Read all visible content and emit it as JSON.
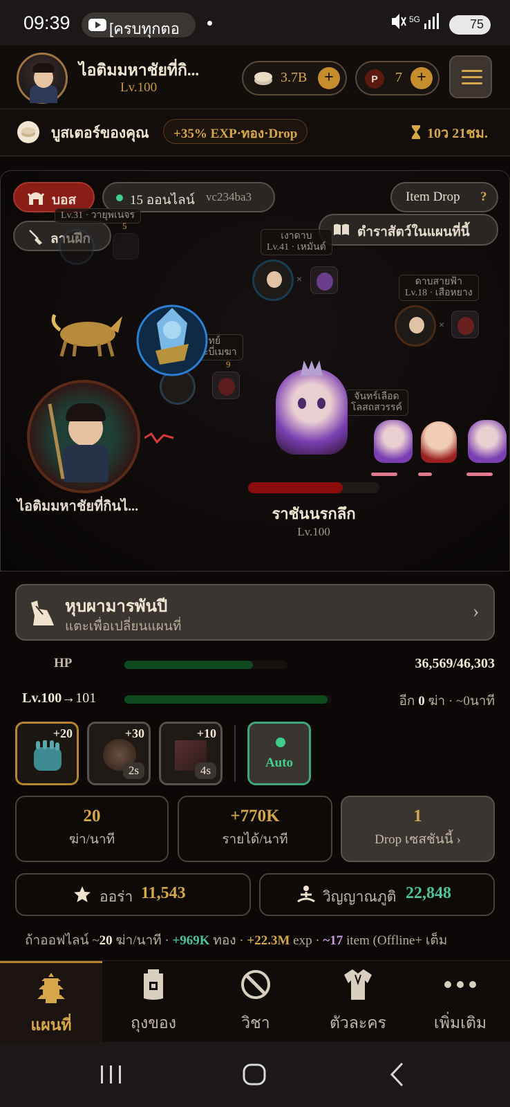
{
  "status_bar": {
    "time": "09:39",
    "notification": "[ครบทุกตอ",
    "network": "5G",
    "battery": "75"
  },
  "header": {
    "player_name": "ไอติมมหาชัยที่กิ...",
    "player_level": "Lv.100",
    "gold": "3.7B",
    "points_icon": "P",
    "points": "7",
    "menu_icon": "hamburger-icon"
  },
  "booster": {
    "label": "บูสเตอร์ของคุณ",
    "effect": "+35% EXP·ทอง·Drop",
    "time_left": "10ว 21ชม."
  },
  "battle": {
    "boss_tab": "บอส",
    "online_count": "15 ออนไลน์",
    "server_code": "vc234ba3",
    "item_drop": "Item Drop",
    "item_drop_help": "?",
    "training_tab": "ลานฝึก",
    "bestiary": "ตำราสัตว์ในแผนที่นี้",
    "others": [
      {
        "name": "เงาดาบ",
        "sub": "Lv.41 · เหมันต์"
      },
      {
        "name": "ดาบสายฟ้า",
        "sub": "Lv.18 · เสือหยาง"
      },
      {
        "name": "ทย์",
        "sub": "กระบี่เมฆา",
        "count": "9"
      },
      {
        "name": "จันทร์เลือด",
        "sub": "โลสถสวรรค์"
      },
      {
        "name": "",
        "sub": "Lv.31 · วายุพเนจร",
        "count": "5"
      }
    ],
    "player_label": "ไอติมมหาชัยที่กินไ...",
    "boss_name": "ราชันนรกลึก",
    "boss_level": "Lv.100",
    "boss_hp_fraction": 0.72
  },
  "map": {
    "title": "หุบผามารพันปี",
    "subtitle": "แตะเพื่อเปลี่ยนแผนที่",
    "chevron": "›"
  },
  "stats": {
    "hp_label": "HP",
    "hp_value": "36,569/46,303",
    "hp_fraction": 0.79,
    "level_from": "Lv.100",
    "arrow": "→",
    "level_to": "101",
    "exp_fraction": 0.98,
    "exp_remaining_prefix": "อีก",
    "exp_remaining_count": "0",
    "exp_remaining_suffix": "ฆ่า · ~0นาที"
  },
  "skills": [
    {
      "bonus": "+20",
      "cooldown": ""
    },
    {
      "bonus": "+30",
      "cooldown": "2s"
    },
    {
      "bonus": "+10",
      "cooldown": "4s"
    }
  ],
  "auto_label": "Auto",
  "summary": {
    "kills_value": "20",
    "kills_label": "ฆ่า/นาที",
    "income_value": "+770K",
    "income_label": "รายได้/นาที",
    "drop_value": "1",
    "drop_label": "Drop เซสชันนี้ ›"
  },
  "aura": {
    "label": "ออร่า",
    "value": "11,543"
  },
  "spirit": {
    "label": "วิญญาณภูติ",
    "value": "22,848"
  },
  "offline": {
    "prefix": "ถ้าออฟไลน์ ~",
    "kills": "20",
    "kills_suffix": " ฆ่า/นาที · ",
    "gold": "+969K",
    "gold_suffix": " ทอง · ",
    "exp": "+22.3M",
    "exp_suffix": " exp · ",
    "items": "~17",
    "items_suffix": " item (Offline+ เต็ม"
  },
  "nav": [
    {
      "label": "แผนที่",
      "icon": "pagoda-icon"
    },
    {
      "label": "ถุงของ",
      "icon": "bag-icon"
    },
    {
      "label": "วิชา",
      "icon": "sword-icon"
    },
    {
      "label": "ตัวละคร",
      "icon": "robe-icon"
    },
    {
      "label": "เพิ่มเติม",
      "icon": "more-icon"
    }
  ],
  "colors": {
    "gold_accent": "#d6a74a",
    "hp_green": "#0e4a1e",
    "boss_hp_red": "#8c0b0b",
    "auto_green": "#3fa87a"
  }
}
